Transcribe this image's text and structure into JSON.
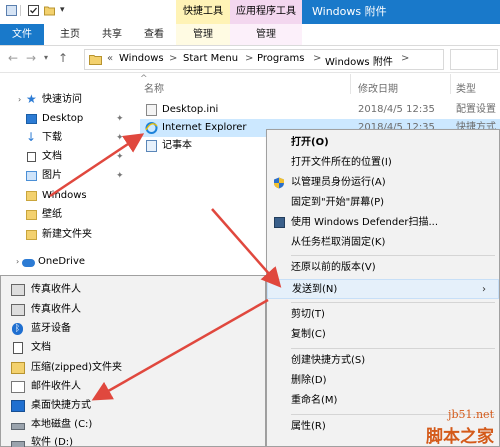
{
  "window": {
    "title": "Windows 附件",
    "context_tab_1": "快捷工具",
    "context_tab_2": "应用程序工具"
  },
  "ribbon_tabs": [
    "文件",
    "主页",
    "共享",
    "查看",
    "管理",
    "管理"
  ],
  "address": {
    "prefix": "«",
    "crumbs": [
      "Windows",
      "Start Menu",
      "Programs",
      "Windows 附件"
    ],
    "separator": ">"
  },
  "nav": {
    "items": [
      {
        "label": "快速访问",
        "icon": "star-icon"
      },
      {
        "label": "Desktop",
        "icon": "desktop-icon"
      },
      {
        "label": "下载",
        "icon": "download-icon"
      },
      {
        "label": "文档",
        "icon": "document-icon"
      },
      {
        "label": "图片",
        "icon": "picture-icon"
      },
      {
        "label": "Windows",
        "icon": "folder-icon"
      },
      {
        "label": "壁纸",
        "icon": "folder-icon"
      },
      {
        "label": "新建文件夹",
        "icon": "folder-icon"
      },
      {
        "label": "OneDrive",
        "icon": "cloud-icon"
      }
    ]
  },
  "file_list": {
    "columns": {
      "name": "名称",
      "date": "修改日期",
      "type": "类型"
    },
    "rows": [
      {
        "name": "Desktop.ini",
        "date": "2018/4/5 12:35",
        "type": "配置设置",
        "icon": "settings-file-icon"
      },
      {
        "name": "Internet Explorer",
        "date": "2018/4/5 12:35",
        "type": "快捷方式",
        "icon": "ie-icon",
        "selected": true
      },
      {
        "name": "记事本",
        "date": "",
        "type": "",
        "icon": "notepad-icon"
      }
    ]
  },
  "context_menu": {
    "items": [
      {
        "label": "打开(O)",
        "bold": true
      },
      {
        "label": "打开文件所在的位置(I)"
      },
      {
        "label": "以管理员身份运行(A)",
        "icon": "shield-icon"
      },
      {
        "label": "固定到\"开始\"屏幕(P)"
      },
      {
        "label": "使用 Windows Defender扫描...",
        "icon": "defender-icon"
      },
      {
        "label": "从任务栏取消固定(K)"
      },
      {
        "label": "还原以前的版本(V)"
      },
      {
        "label": "发送到(N)",
        "highlighted": true,
        "submenu": true
      },
      {
        "label": "剪切(T)"
      },
      {
        "label": "复制(C)"
      },
      {
        "label": "创建快捷方式(S)"
      },
      {
        "label": "删除(D)"
      },
      {
        "label": "重命名(M)"
      },
      {
        "label": "属性(R)"
      }
    ]
  },
  "send_to": {
    "items": [
      {
        "label": "传真收件人",
        "icon": "fax-icon"
      },
      {
        "label": "传真收件人",
        "icon": "fax-icon"
      },
      {
        "label": "蓝牙设备",
        "icon": "bluetooth-icon"
      },
      {
        "label": "文档",
        "icon": "document-icon"
      },
      {
        "label": "压缩(zipped)文件夹",
        "icon": "zip-folder-icon"
      },
      {
        "label": "邮件收件人",
        "icon": "mail-icon"
      },
      {
        "label": "桌面快捷方式",
        "icon": "desktop-icon"
      },
      {
        "label": "本地磁盘 (C:)",
        "icon": "drive-icon"
      },
      {
        "label": "软件 (D:)",
        "icon": "drive-icon"
      }
    ]
  },
  "watermark": {
    "site": "jb51.net",
    "brand": "脚本之家"
  },
  "colors": {
    "accent": "#1979ca",
    "context_tab_shortcut": "#fff3b6",
    "context_tab_app": "#f3d7ef",
    "selection": "#cce8ff",
    "arrow": "#e0483e"
  }
}
